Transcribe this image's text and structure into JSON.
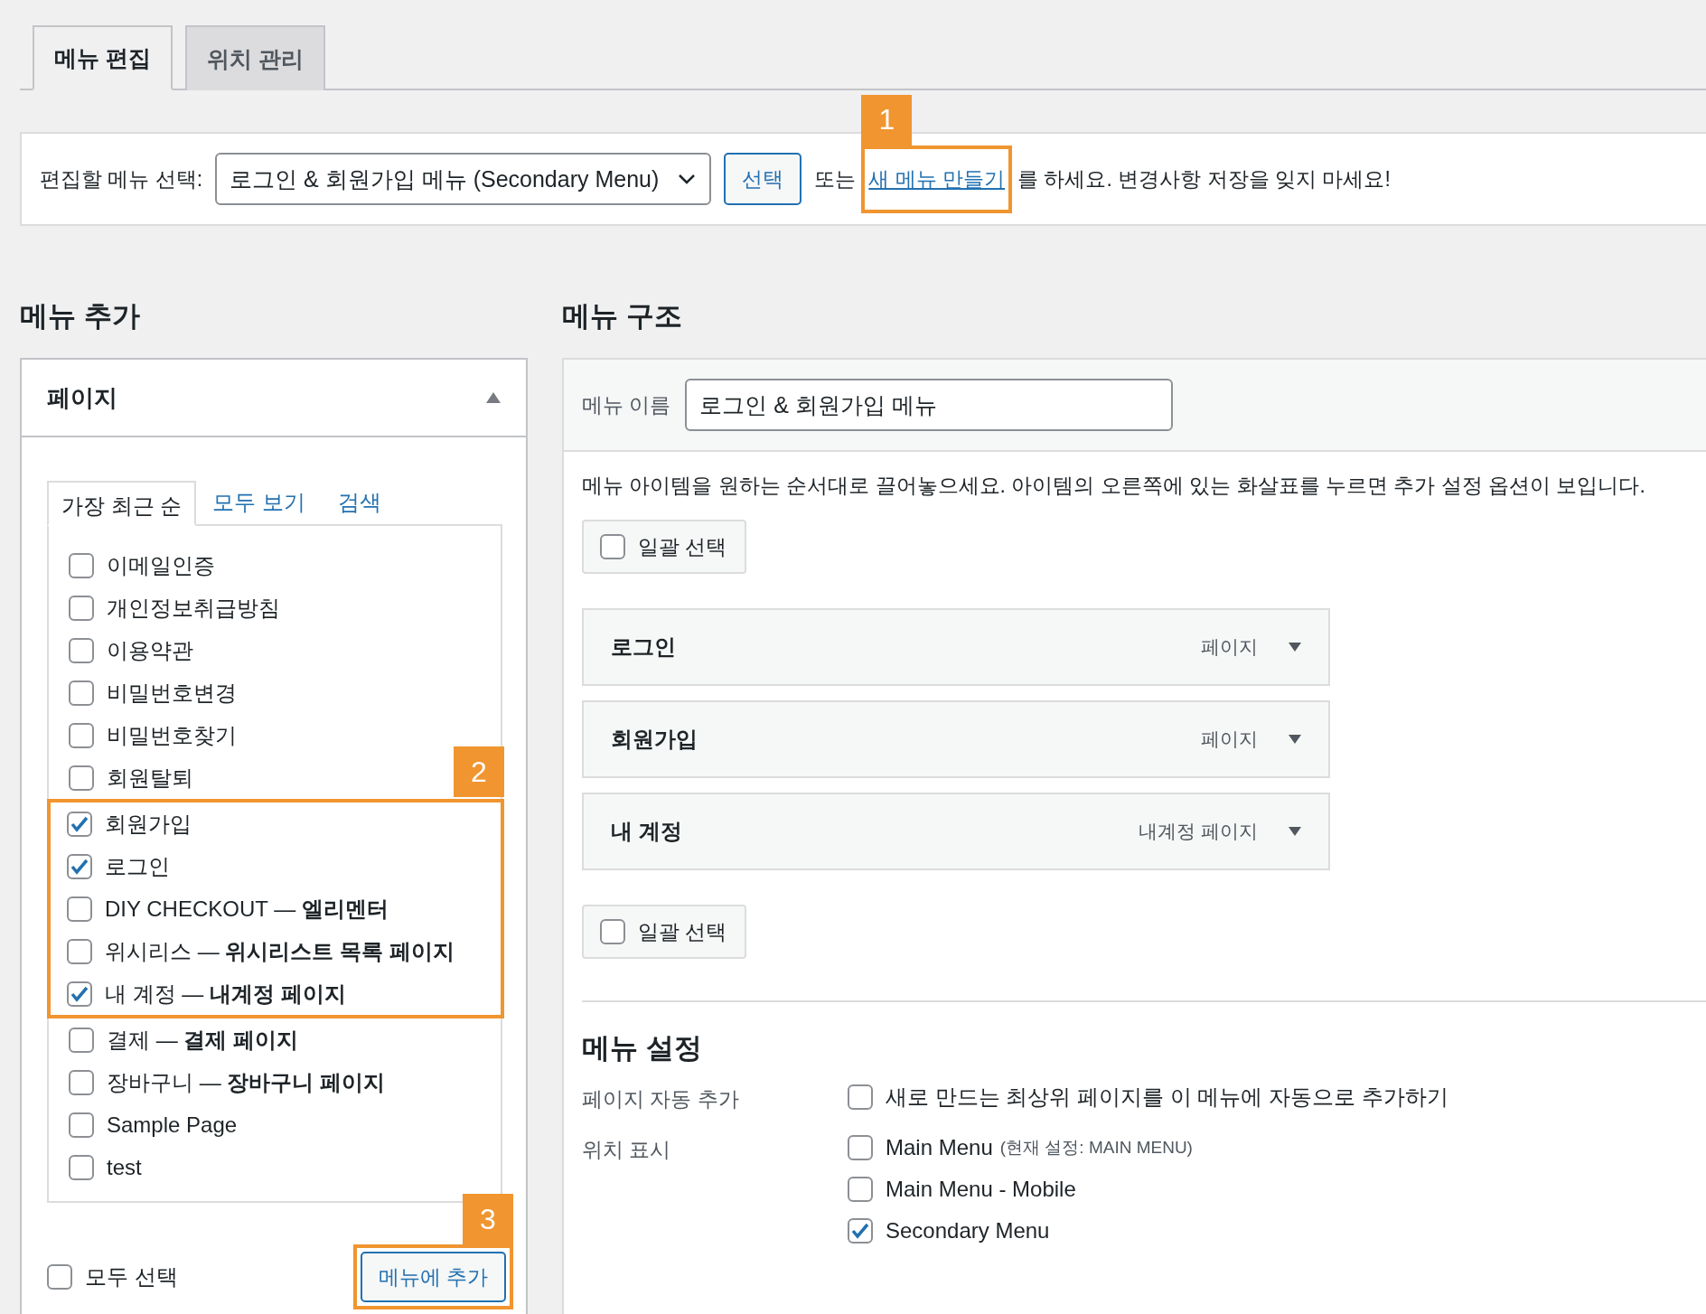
{
  "tabs": [
    {
      "label": "메뉴 편집",
      "selected": true
    },
    {
      "label": "위치 관리",
      "selected": false
    }
  ],
  "menu_select": {
    "label": "편집할 메뉴 선택:",
    "value": "로그인 & 회원가입 메뉴 (Secondary Menu)",
    "button": "선택",
    "text_before": "또는",
    "link": "새 메뉴 만들기",
    "text_after": "를 하세요. 변경사항 저장을 잊지 마세요!",
    "callout": "1"
  },
  "add_menu": {
    "heading": "메뉴 추가",
    "panel": {
      "title": "페이지",
      "expanded": true,
      "tabs": [
        {
          "label": "가장 최근 순",
          "selected": true
        },
        {
          "label": "모두 보기",
          "selected": false
        },
        {
          "label": "검색",
          "selected": false
        }
      ],
      "highlight_callout": "2",
      "items": [
        {
          "label": "이메일인증",
          "checked": false,
          "highlighted": false
        },
        {
          "label": "개인정보취급방침",
          "checked": false,
          "highlighted": false
        },
        {
          "label": "이용약관",
          "checked": false,
          "highlighted": false
        },
        {
          "label": "비밀번호변경",
          "checked": false,
          "highlighted": false
        },
        {
          "label": "비밀번호찾기",
          "checked": false,
          "highlighted": false
        },
        {
          "label": "회원탈퇴",
          "checked": false,
          "highlighted": false
        },
        {
          "label": "회원가입",
          "checked": true,
          "highlighted": true
        },
        {
          "label": "로그인",
          "checked": true,
          "highlighted": true
        },
        {
          "label": "DIY CHECKOUT — **엘리멘터**",
          "checked": false,
          "highlighted": true
        },
        {
          "label": "위시리스 — **위시리스트 목록 페이지**",
          "checked": false,
          "highlighted": true
        },
        {
          "label": "내 계정 — **내계정 페이지**",
          "checked": true,
          "highlighted": true
        },
        {
          "label": "결제 — **결제 페이지**",
          "checked": false,
          "highlighted": false
        },
        {
          "label": "장바구니 — **장바구니 페이지**",
          "checked": false,
          "highlighted": false
        },
        {
          "label": "Sample Page",
          "checked": false,
          "highlighted": false
        },
        {
          "label": "test",
          "checked": false,
          "highlighted": false
        }
      ],
      "select_all": {
        "label": "모두 선택",
        "checked": false
      },
      "add_button": {
        "label": "메뉴에 추가",
        "callout": "3"
      }
    }
  },
  "structure": {
    "heading": "메뉴 구조",
    "name_label": "메뉴 이름",
    "name_value": "로그인 & 회원가입 메뉴",
    "instructions": "메뉴 아이템을 원하는 순서대로 끌어놓으세요. 아이템의 오른쪽에 있는 화살표를 누르면 추가 설정 옵션이 보입니다.",
    "bulk_select_top": {
      "label": "일괄 선택",
      "checked": false
    },
    "items": [
      {
        "title": "로그인",
        "type": "페이지"
      },
      {
        "title": "회원가입",
        "type": "페이지"
      },
      {
        "title": "내 계정",
        "type": "내계정 페이지"
      }
    ],
    "bulk_select_bottom": {
      "label": "일괄 선택",
      "checked": false
    },
    "settings": {
      "heading": "메뉴 설정",
      "rows": [
        {
          "label": "페이지 자동 추가",
          "options": [
            {
              "label": "새로 만드는 최상위 페이지를 이 메뉴에 자동으로 추가하기",
              "checked": false
            }
          ]
        },
        {
          "label": "위치 표시",
          "options": [
            {
              "label": "Main Menu",
              "note": "(현재 설정: MAIN MENU)",
              "checked": false
            },
            {
              "label": "Main Menu - Mobile",
              "checked": false
            },
            {
              "label": "Secondary Menu",
              "checked": true
            }
          ]
        }
      ]
    }
  }
}
